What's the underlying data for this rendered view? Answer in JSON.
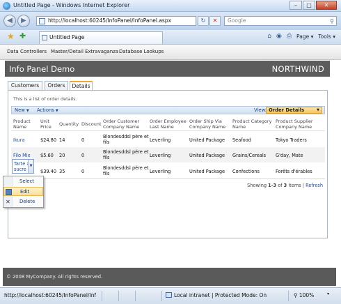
{
  "window": {
    "title": "Untitled Page - Windows Internet Explorer",
    "minimize": "–",
    "maximize": "□",
    "close": "✕"
  },
  "nav": {
    "back_icon": "◀",
    "forward_icon": "▶",
    "address": "http://localhost:60245/InfoPanel/InfoPanel.aspx",
    "refresh_icon": "↻",
    "stop_icon": "✕",
    "search_placeholder": "Google",
    "search_icon": "⚲"
  },
  "tabbar": {
    "tab_title": "Untitled Page",
    "favorites_icon": "★",
    "add_favorites_icon": "✚",
    "commands": {
      "home_icon": "⌂",
      "feeds_icon": "◉",
      "print_icon": "⎙",
      "page_label": "Page",
      "tools_label": "Tools",
      "caret": "▾"
    }
  },
  "app": {
    "menu": [
      "Data Controllers",
      "Master/Detail Extravaganza",
      "Database Lookups"
    ],
    "title": "Info Panel Demo",
    "brand": "NORTHWIND",
    "tabs": [
      "Customers",
      "Orders",
      "Details"
    ],
    "description": "This is a list of order details.",
    "toolbar": {
      "new_label": "New",
      "actions_label": "Actions",
      "view_label": "View:",
      "view_value": "Order Details",
      "caret": "▼"
    },
    "columns": [
      [
        "Product",
        "Name"
      ],
      [
        "Unit",
        "Price"
      ],
      [
        "Quantity"
      ],
      [
        "Discount"
      ],
      [
        "Order Customer",
        "Company Name"
      ],
      [
        "Order Employee",
        "Last Name"
      ],
      [
        "Order Ship Via",
        "Company Name"
      ],
      [
        "Product Category",
        "Name"
      ],
      [
        "Product Supplier",
        "Company Name"
      ]
    ],
    "rows": [
      {
        "product": [
          "Ikura"
        ],
        "price": "$24.80",
        "qty": "14",
        "discount": "0",
        "customer": [
          "Blondesddsl père et",
          "fils"
        ],
        "employee": "Leverling",
        "shipper": "United Package",
        "category": "Seafood",
        "supplier": "Tokyo Traders"
      },
      {
        "product": [
          "Filo Mix"
        ],
        "price": "$5.60",
        "qty": "20",
        "discount": "0",
        "customer": [
          "Blondesddsl père et",
          "fils"
        ],
        "employee": "Leverling",
        "shipper": "United Package",
        "category": "Grains/Cereals",
        "supplier": "G'day, Mate"
      },
      {
        "product": [
          "Tarte a",
          "sucre"
        ],
        "price": "$39.40",
        "qty": "35",
        "discount": "0",
        "customer": [
          "Blondesddsl père et",
          "fils"
        ],
        "employee": "Leverling",
        "shipper": "United Package",
        "category": "Confections",
        "supplier": "Forêts d'érables"
      }
    ],
    "pager": {
      "prefix": "Showing ",
      "range": "1-3",
      "of": " of ",
      "total": "3",
      "suffix": " items | ",
      "refresh": "Refresh"
    },
    "context_menu": [
      {
        "label": "Select",
        "icon": ""
      },
      {
        "label": "Edit",
        "icon": ""
      },
      {
        "label": "Delete",
        "icon": "✕"
      }
    ],
    "footer": "© 2008 MyCompany.  All rights reserved."
  },
  "status": {
    "url": "http://localhost:60245/InfoPanel/InfoPa",
    "zone": "Local intranet | Protected Mode: On",
    "zoom": "100%",
    "zoom_icon": "⚲",
    "caret": "▾"
  }
}
